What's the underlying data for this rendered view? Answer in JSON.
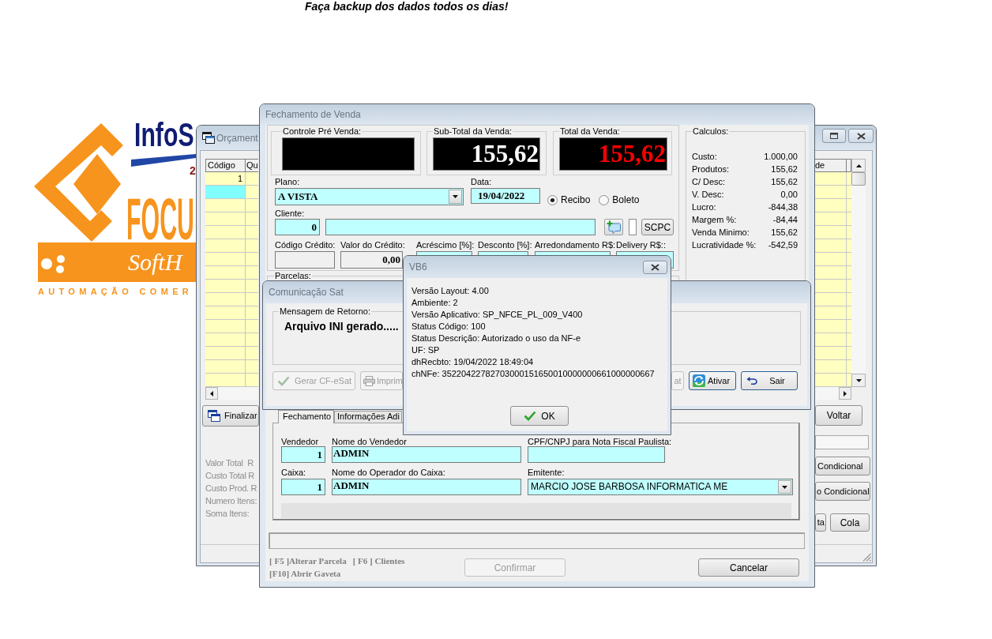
{
  "banner": {
    "text": "Faça backup dos dados todos os dias!"
  },
  "logo": {
    "brand_top": "InfoS",
    "brand_mark": "2",
    "brand_main": "FOCU",
    "band_text": "SoftH",
    "subtitle": "AUTOMAÇÃO COMER"
  },
  "orcamento": {
    "title": "Orçament",
    "grid": {
      "columns": [
        "Código",
        "Qu"
      ],
      "right_column_fragment": "de",
      "rows": [
        {
          "codigo": "1",
          "selected": false
        },
        {
          "selected": true
        }
      ]
    },
    "left_button": "Finalizar",
    "summary_labels": [
      "Valor Total  R",
      "Custo Total R",
      "Custo Prod. R",
      "Numero Itens:",
      "Soma Itens:"
    ],
    "voltar_button": "Voltar",
    "side_buttons": [
      "Condicional",
      "o Condicional"
    ],
    "bottom_buttons": [
      "ta",
      "Cola"
    ]
  },
  "fechamento": {
    "title": "Fechamento de Venda",
    "displays": [
      {
        "label": "Controle Pré Venda:"
      },
      {
        "label": "Sub-Total da Venda:",
        "value": "155,62",
        "color": "#ffffff"
      },
      {
        "label": "Total da Venda:",
        "value": "155,62",
        "color": "#ff0000"
      }
    ],
    "plano": {
      "label": "Plano:",
      "value": "A VISTA"
    },
    "data": {
      "label": "Data:",
      "value": "19/04/2022"
    },
    "document_type": [
      {
        "label": "Recibo",
        "selected": true
      },
      {
        "label": "Boleto",
        "selected": false
      }
    ],
    "cliente": {
      "label": "Cliente:",
      "code": "0"
    },
    "scpc_button": "SCPC",
    "credit_fields": [
      {
        "label": "Código Crédito:",
        "disabled": true
      },
      {
        "label": "Valor do Crédito:",
        "value": "0,00",
        "disabled": true
      },
      {
        "label": "Acréscimo [%]:",
        "disabled": false
      },
      {
        "label": "Desconto [%]:",
        "disabled": false
      },
      {
        "label": "Arredondamento R$:",
        "disabled": false
      },
      {
        "label": "Delivery R$::",
        "disabled": false
      }
    ],
    "parcelas_label": "Parcelas:",
    "calculos": {
      "label": "Calculos:",
      "rows": [
        {
          "label": "Custo:",
          "value": "1.000,00"
        },
        {
          "label": "Produtos:",
          "value": "155,62"
        },
        {
          "label": "C/ Desc:",
          "value": "155,62"
        },
        {
          "label": "V. Desc:",
          "value": "0,00"
        },
        {
          "label": "Lucro:",
          "value": "-844,38"
        },
        {
          "label": "Margem %:",
          "value": "-84,44"
        },
        {
          "label": "Venda Minimo:",
          "value": "155,62"
        },
        {
          "label": "Lucratividade %:",
          "value": "-542,59"
        }
      ]
    },
    "tabs": [
      {
        "label": "Fechamento",
        "selected": true
      },
      {
        "label": "Informações Adi",
        "selected": false
      }
    ],
    "vendedor": {
      "label": "Vendedor",
      "code": "1"
    },
    "nome_vendedor": {
      "label": "Nome do Vendedor",
      "value": "ADMIN"
    },
    "cpf_cnpj": {
      "label": "CPF/CNPJ para Nota Fiscal Paulista:"
    },
    "caixa": {
      "label": "Caixa:",
      "code": "1"
    },
    "operador": {
      "label": "Nome do Operador do Caixa:",
      "value": "ADMIN"
    },
    "emitente": {
      "label": "Emitente:",
      "value": "MARCIO JOSE BARBOSA INFORMATICA ME"
    },
    "shortcuts": [
      "[ F5 ]Alterar Parcela",
      "[ F6 ] Clientes",
      "[F10] Abrir Gaveta"
    ],
    "buttons": [
      {
        "label": "Confirmar",
        "disabled": true
      },
      {
        "label": "Cancelar",
        "disabled": false
      }
    ]
  },
  "comunicacao": {
    "title": "Comunicação Sat",
    "group_label": "Mensagem de Retorno:",
    "message": "Arquivo INI gerado.....",
    "buttons": [
      {
        "label": "Gerar CF-eSat",
        "disabled": true
      },
      {
        "label": "Imprim",
        "disabled": true
      },
      {
        "label": "at",
        "disabled": true
      },
      {
        "label": "Ativar",
        "disabled": false
      },
      {
        "label": "Sair",
        "disabled": false
      }
    ]
  },
  "dialog": {
    "title": "VB6",
    "lines": [
      "Versão Layout: 4.00",
      "Ambiente: 2",
      "Versão Aplicativo: SP_NFCE_PL_009_V400",
      "Status Código: 100",
      "Status Descrição: Autorizado o uso da NF-e",
      "UF: SP",
      "dhRecbto: 19/04/2022 18:49:04",
      "chNFe: 35220422782703000151650010000000661000000667"
    ],
    "ok_button": "OK"
  }
}
